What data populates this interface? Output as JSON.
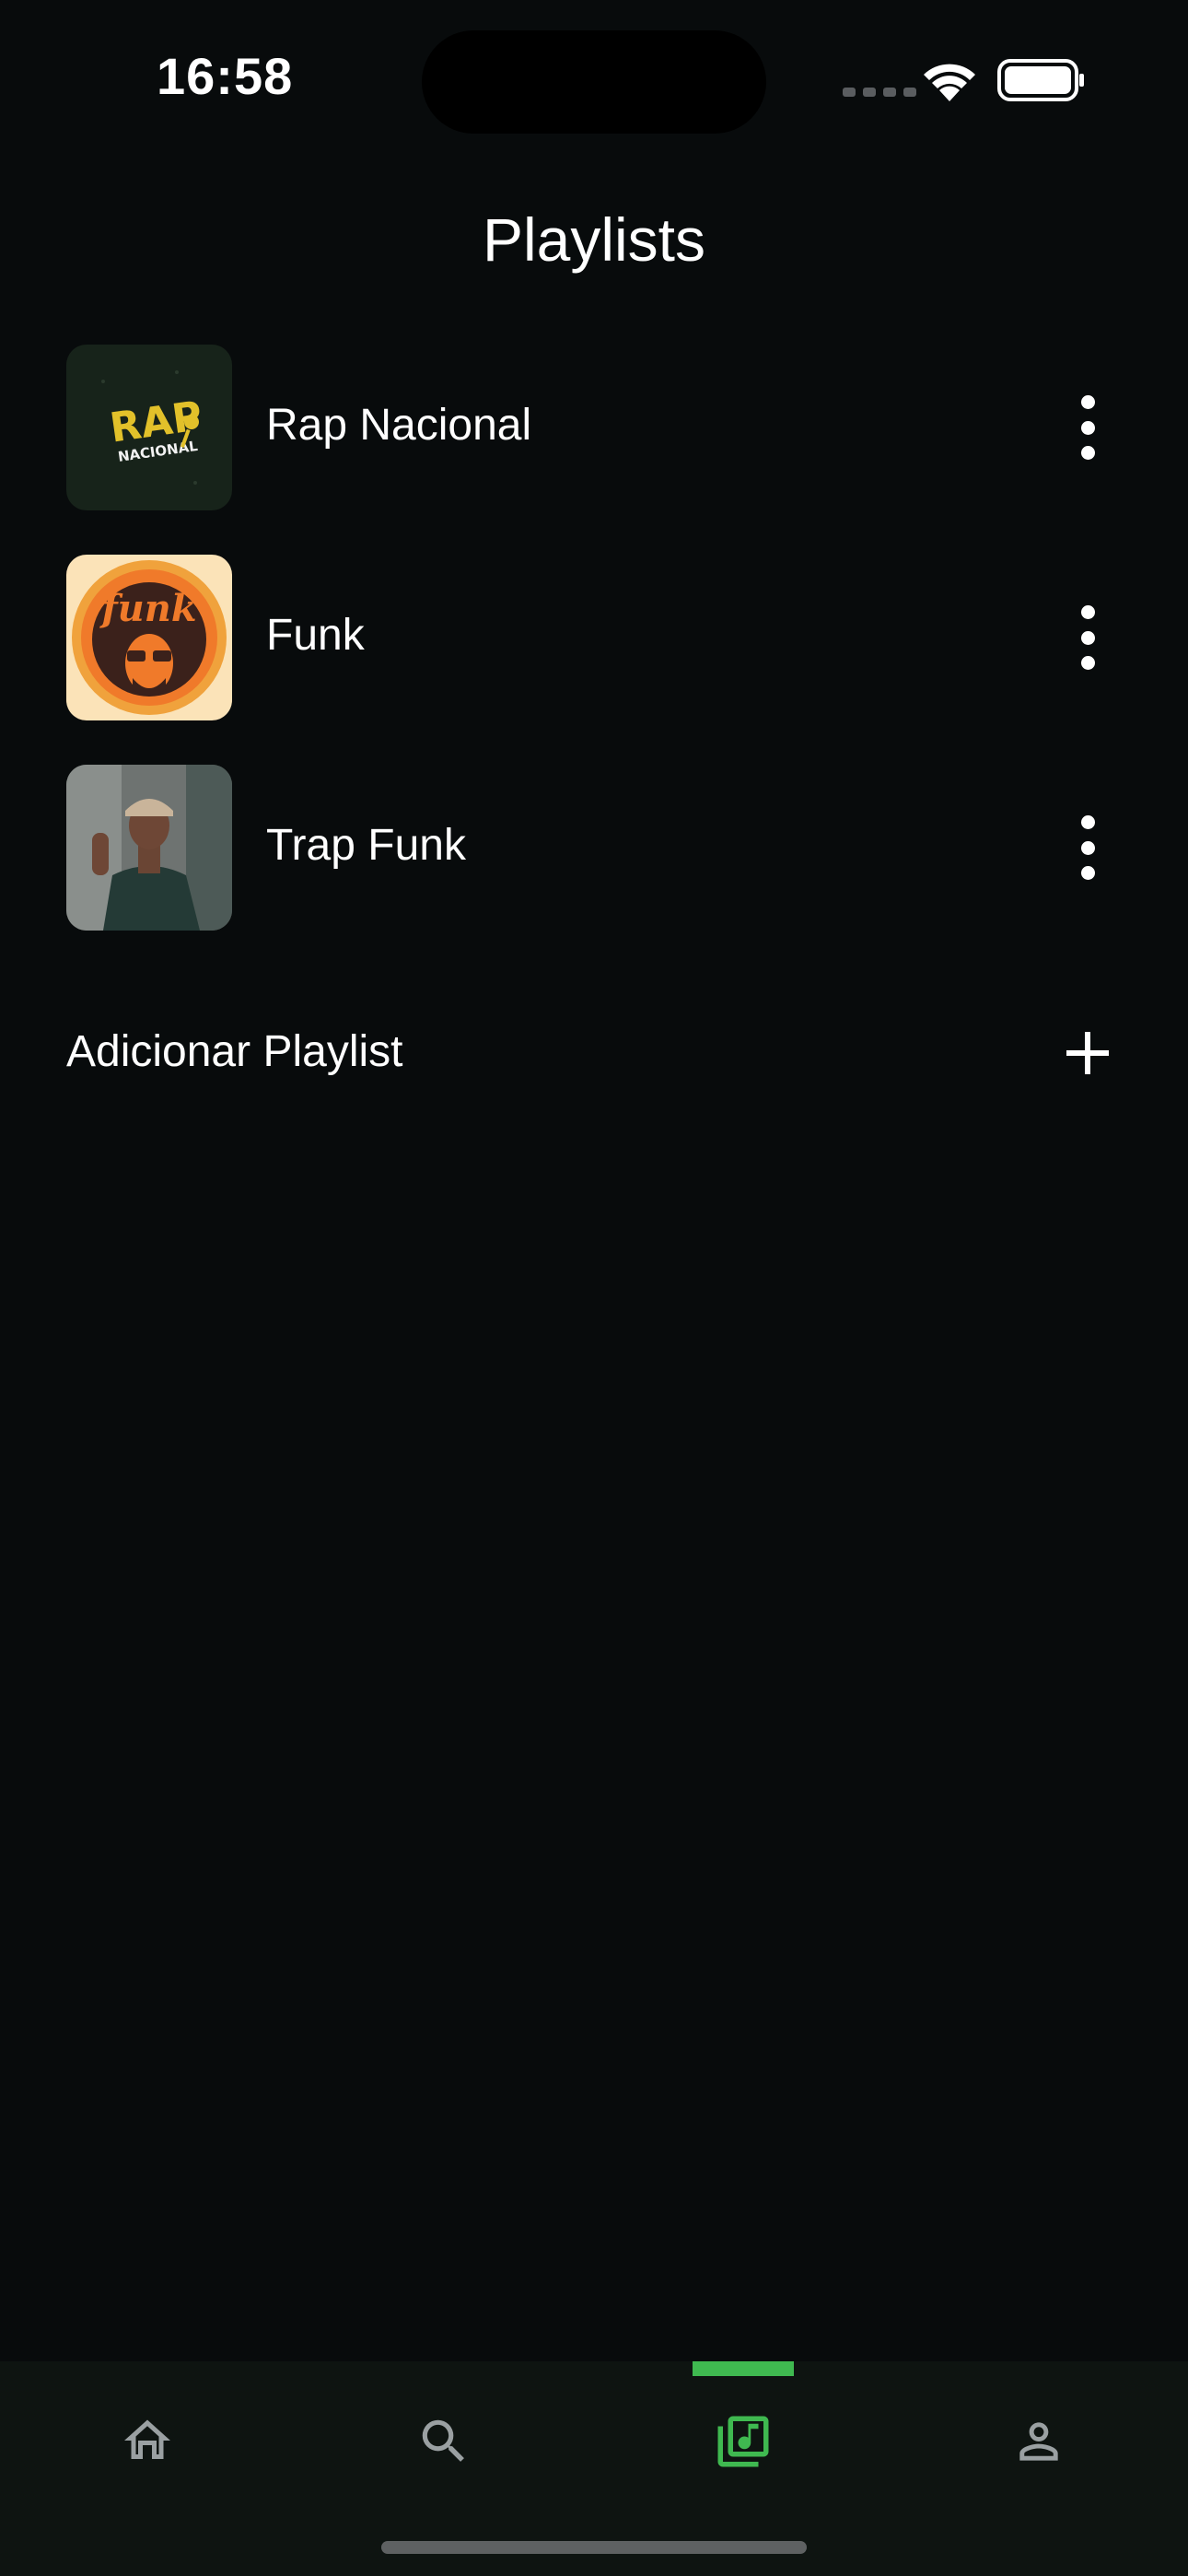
{
  "status_bar": {
    "time": "16:58"
  },
  "header": {
    "title": "Playlists"
  },
  "playlists": [
    {
      "name": "Rap Nacional",
      "cover_text_main": "RAP",
      "cover_text_sub": "NACIONAL"
    },
    {
      "name": "Funk",
      "cover_text_main": "funk"
    },
    {
      "name": "Trap Funk"
    }
  ],
  "add_playlist": {
    "label": "Adicionar Playlist"
  },
  "bottom_nav": {
    "items": [
      {
        "icon": "home-icon",
        "active": false
      },
      {
        "icon": "search-icon",
        "active": false
      },
      {
        "icon": "library-music-icon",
        "active": true
      },
      {
        "icon": "person-icon",
        "active": false
      }
    ]
  },
  "colors": {
    "background": "#080b0c",
    "accent": "#3fb950",
    "nav_background": "#0e1411",
    "inactive_icon": "#9aa0a2"
  }
}
